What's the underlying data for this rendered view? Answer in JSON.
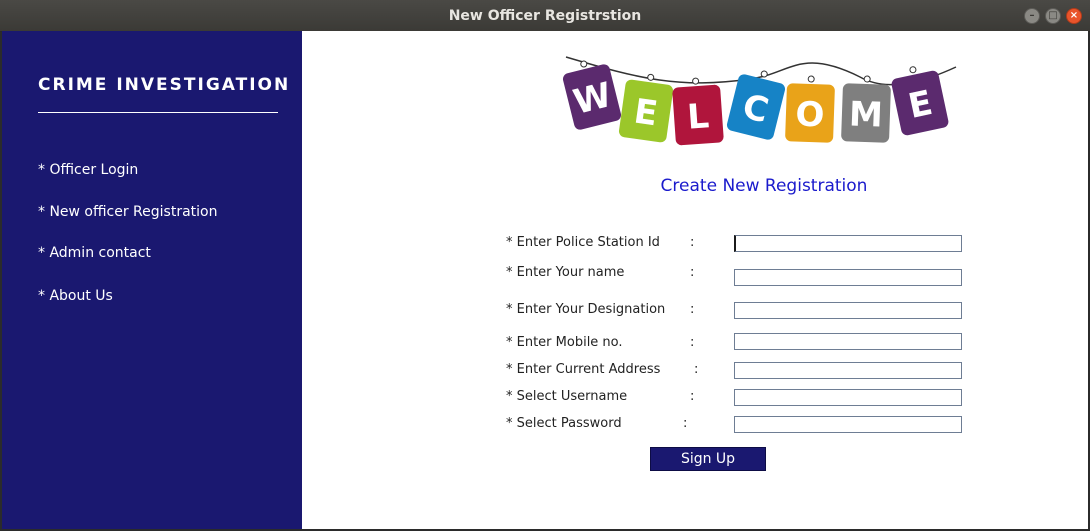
{
  "window": {
    "title": "New Officer Registrstion"
  },
  "sidebar": {
    "brand": "CRIME  INVESTIGATION",
    "items": [
      {
        "label": "* Officer Login"
      },
      {
        "label": "* New officer Registration"
      },
      {
        "label": "* Admin contact"
      },
      {
        "label": "* About Us"
      }
    ]
  },
  "main": {
    "banner": {
      "letters": [
        "W",
        "E",
        "L",
        "C",
        "O",
        "M",
        "E"
      ],
      "colors": [
        "#5b2a6e",
        "#9bc72a",
        "#b0153c",
        "#1683c6",
        "#e9a319",
        "#7f7f7f",
        "#5b2a6e"
      ]
    },
    "heading": "Create New Registration",
    "fields": [
      {
        "label": "* Enter Police Station Id",
        "colon": ":",
        "value": ""
      },
      {
        "label": "* Enter Your name",
        "colon": ":",
        "value": ""
      },
      {
        "label": "* Enter Your Designation",
        "colon": ":",
        "value": ""
      },
      {
        "label": "* Enter Mobile no.",
        "colon": ":",
        "value": ""
      },
      {
        "label": "* Enter Current Address",
        "colon": ":",
        "value": ""
      },
      {
        "label": "* Select Username",
        "colon": ":",
        "value": ""
      },
      {
        "label": "* Select Password",
        "colon": ":",
        "value": ""
      }
    ],
    "signup_label": "Sign Up"
  },
  "colors": {
    "sidebar": "#1a1870",
    "heading": "#1a1acc",
    "button": "#1a1870"
  }
}
